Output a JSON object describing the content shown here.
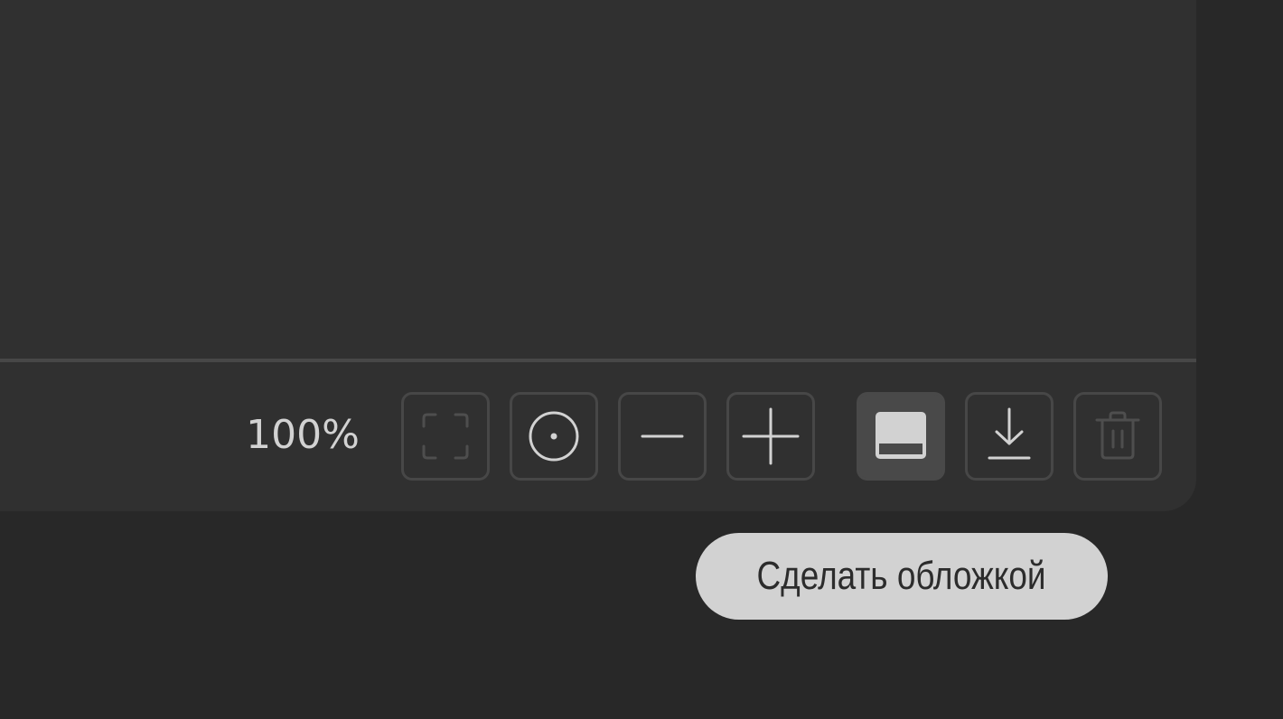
{
  "toolbar": {
    "zoom_level": "100%",
    "buttons": [
      {
        "id": "fullscreen",
        "icon": "fullscreen-icon",
        "enabled": false
      },
      {
        "id": "center",
        "icon": "center-target-icon",
        "enabled": true
      },
      {
        "id": "zoom-out",
        "icon": "minus-icon",
        "enabled": true
      },
      {
        "id": "zoom-in",
        "icon": "plus-icon",
        "enabled": true
      },
      {
        "id": "set-cover",
        "icon": "cover-icon",
        "active": true
      },
      {
        "id": "download",
        "icon": "download-icon",
        "enabled": true
      },
      {
        "id": "delete",
        "icon": "trash-icon",
        "enabled": false
      }
    ]
  },
  "tooltip": {
    "text": "Сделать обложкой"
  },
  "colors": {
    "background": "#282828",
    "panel": "#303030",
    "divider": "#474747",
    "button_border": "#474747",
    "active_button": "#494949",
    "icon": "#d2d2d2",
    "icon_disabled": "#4e4e4e",
    "tooltip_bg": "#d2d2d2",
    "tooltip_text": "#2c2c2c"
  }
}
